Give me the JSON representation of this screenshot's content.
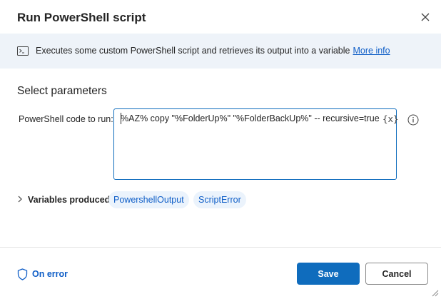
{
  "dialog": {
    "title": "Run PowerShell script",
    "close_icon": "close-icon"
  },
  "info": {
    "icon": "terminal-icon",
    "text": "Executes some custom PowerShell script and retrieves its output into a variable",
    "link": "More info"
  },
  "parameters": {
    "section_title": "Select parameters",
    "code_label": "PowerShell code to run:",
    "code_value": "%AZ% copy \"%FolderUp%\" \"%FolderBackUp%\" -- recursive=true",
    "variable_picker": "{x}",
    "help_icon": "info-circle-icon"
  },
  "variables": {
    "label": "Variables produced",
    "items": [
      "PowershellOutput",
      "ScriptError"
    ]
  },
  "footer": {
    "on_error_label": "On error",
    "on_error_icon": "shield-icon",
    "save_label": "Save",
    "cancel_label": "Cancel"
  },
  "colors": {
    "accent": "#0f6cbd",
    "link": "#0f5ec7",
    "info_bar_bg": "#eef3f9",
    "chip_bg": "#ebf3fc"
  }
}
